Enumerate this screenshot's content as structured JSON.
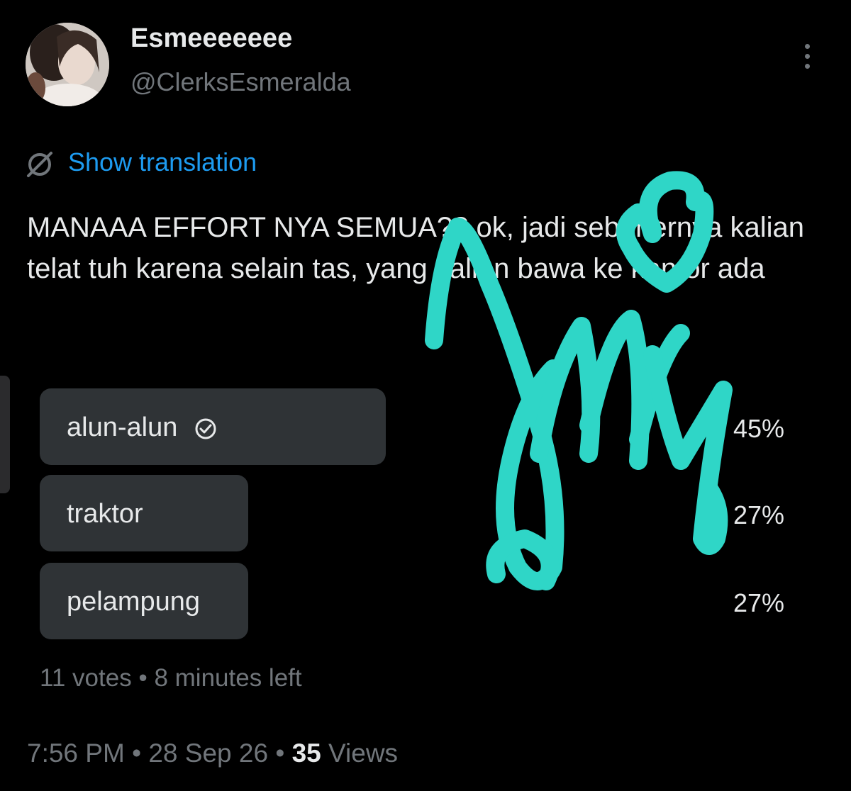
{
  "author": {
    "display_name": "Esmeeeeeee",
    "handle": "@ClerksEsmeralda",
    "avatar_icon": "profile-photo"
  },
  "translation": {
    "label": "Show translation",
    "icon": "globe-slash-icon"
  },
  "tweet": {
    "text": "MANAAA EFFORT NYA SEMUA?? ok, jadi sebenernya kalian telat tuh karena selain tas, yang kalian bawa ke kantor ada"
  },
  "poll": {
    "options": [
      {
        "label": "alun-alun",
        "percent": "45%",
        "fill": 0.45,
        "selected": true
      },
      {
        "label": "traktor",
        "percent": "27%",
        "fill": 0.27,
        "selected": false
      },
      {
        "label": "pelampung",
        "percent": "27%",
        "fill": 0.27,
        "selected": false
      }
    ],
    "votes": "11 votes",
    "separator": "•",
    "time_left": "8 minutes left"
  },
  "footer": {
    "time": "7:56 PM",
    "date": "28 Sep 26",
    "views_count": "35",
    "views_label": "Views",
    "separator": "•"
  },
  "colors": {
    "background": "#000000",
    "text": "#e7e9ea",
    "muted": "#71767b",
    "link": "#1d9bf0",
    "poll_bar": "#2f3336",
    "scribble": "#2fd6c7"
  }
}
